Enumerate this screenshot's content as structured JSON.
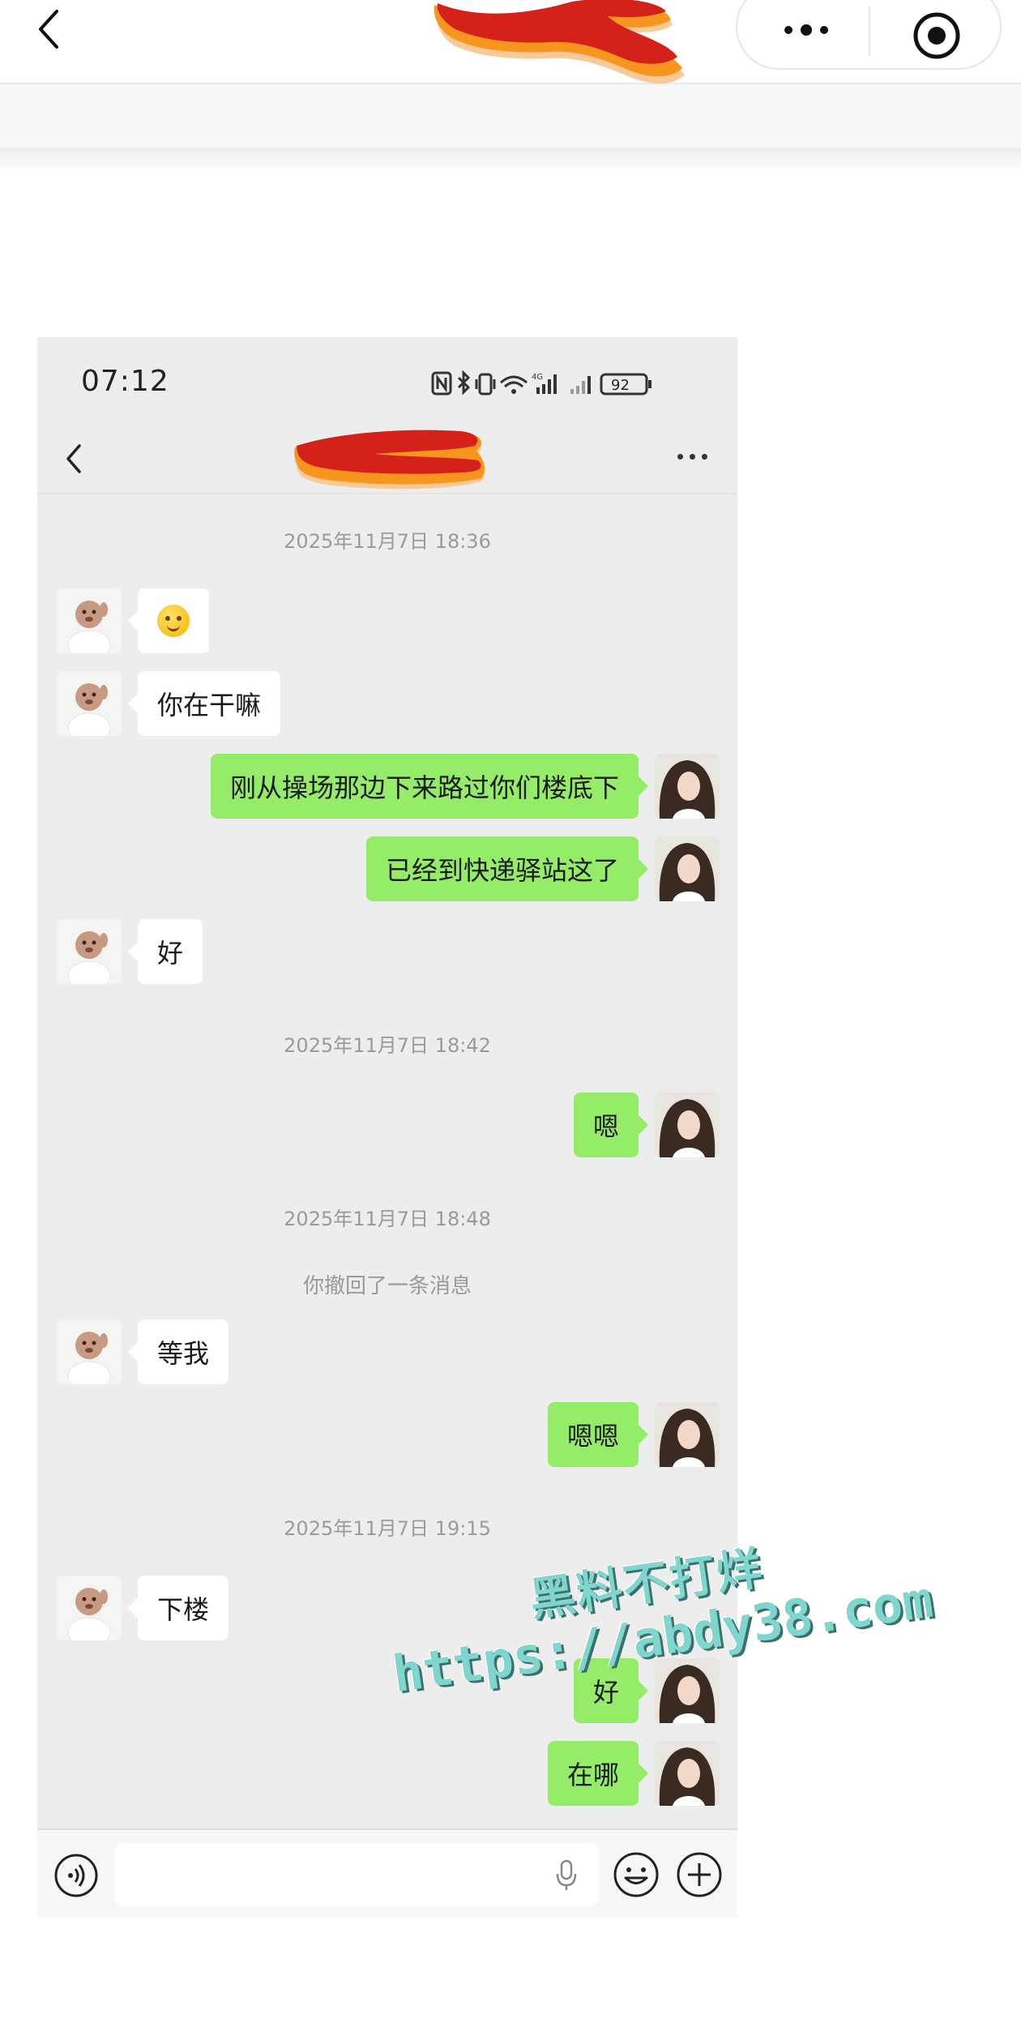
{
  "outer": {
    "back_icon": "chevron-left-icon",
    "more_icon": "more-dots-icon",
    "target_icon": "record-target-icon"
  },
  "status_bar": {
    "time": "07:12",
    "battery": "92"
  },
  "chat": {
    "back_icon": "chevron-left-icon",
    "more_icon": "ellipsis-icon",
    "messages": {
      "ts1": "2025年11月7日 18:36",
      "m1_emoji": "smile-emoji",
      "m2": "你在干嘛",
      "m3": "刚从操场那边下来路过你们楼底下",
      "m4": "已经到快递驿站这了",
      "m5": "好",
      "ts2": "2025年11月7日 18:42",
      "m6": "嗯",
      "ts3": "2025年11月7日 18:48",
      "sys1": "你撤回了一条消息",
      "m7": "等我",
      "m8": "嗯嗯",
      "ts4": "2025年11月7日 19:15",
      "m9": "下楼",
      "m10": "好",
      "m11": "在哪"
    },
    "input": {
      "value": "",
      "voice_icon": "voice-icon",
      "mic_icon": "microphone-icon",
      "emoji_icon": "emoji-icon",
      "plus_icon": "plus-icon"
    }
  },
  "watermark": {
    "line1": "黑料不打烊",
    "line2": "https://abdy38.com"
  },
  "colors": {
    "chat_bg": "#ededed",
    "bubble_self": "#95ec69",
    "bubble_other": "#ffffff",
    "watermark": "#7ed6cf",
    "scribble_red": "#d4221b",
    "scribble_orange": "#f7961e"
  }
}
